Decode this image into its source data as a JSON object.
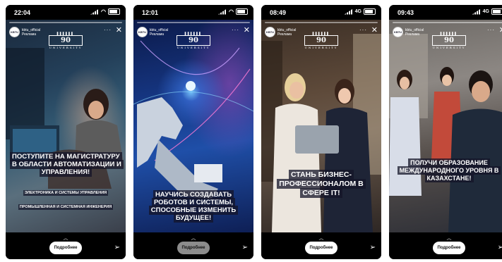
{
  "phones": [
    {
      "status_time": "22:04",
      "network": "",
      "account_name": "kbtu_official",
      "account_sub": "Реклама",
      "caption": "Поступите на магистратуру в области автоматизации и управления!",
      "sub1": "Электроника и системы управления",
      "sub2": "Промышленная и системная инженерия",
      "button": "Подробнее"
    },
    {
      "status_time": "12:01",
      "network": "",
      "account_name": "kbtu_official",
      "account_sub": "Реклама",
      "caption": "Научись создавать роботов и системы, способные изменить будущее!",
      "button": "Подробнее"
    },
    {
      "status_time": "08:49",
      "network": "4G",
      "account_name": "kbtu_official",
      "account_sub": "Реклама",
      "caption": "Стань бизнес-профессионалом в сфере IT!",
      "button": "Подробнее"
    },
    {
      "status_time": "09:43",
      "network": "4G",
      "account_name": "kbtu_official",
      "account_sub": "Реклама",
      "caption": "Получи образование международного уровня в Казахстане!",
      "button": "Подробнее"
    }
  ],
  "logo": {
    "number": "90",
    "word": "UNIVERSITY"
  },
  "icons": {
    "close": "close-icon",
    "send": "send-icon",
    "chevron": "chevron-up-icon",
    "more": "more-dots-icon"
  }
}
